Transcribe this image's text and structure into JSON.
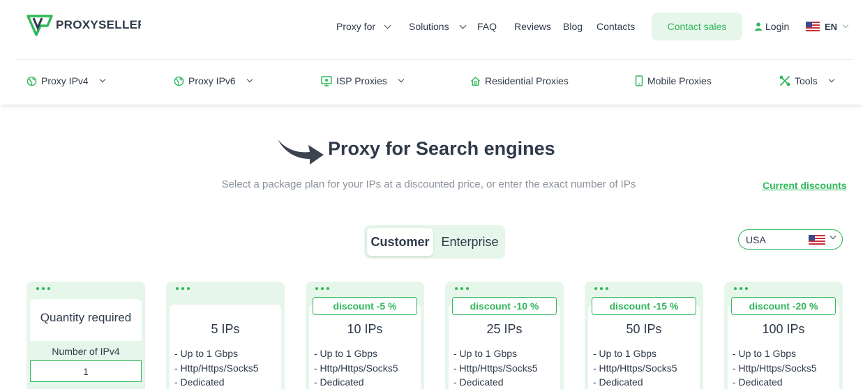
{
  "header": {
    "logo_text": "PROXYSELLER",
    "nav": [
      {
        "label": "Proxy for",
        "dropdown": true
      },
      {
        "label": "Solutions",
        "dropdown": true
      },
      {
        "label": "FAQ",
        "dropdown": false
      },
      {
        "label": "Reviews",
        "dropdown": false
      },
      {
        "label": "Blog",
        "dropdown": false
      },
      {
        "label": "Contacts",
        "dropdown": false
      }
    ],
    "contact_sales": "Contact sales",
    "login": "Login",
    "language": "EN"
  },
  "product_nav": [
    {
      "label": "Proxy IPv4",
      "icon": "globe-icon",
      "dropdown": true
    },
    {
      "label": "Proxy IPv6",
      "icon": "globe-icon",
      "dropdown": true
    },
    {
      "label": "ISP Proxies",
      "icon": "monitor-icon",
      "dropdown": true
    },
    {
      "label": "Residential Proxies",
      "icon": "home-icon",
      "dropdown": false
    },
    {
      "label": "Mobile Proxies",
      "icon": "phone-icon",
      "dropdown": false
    },
    {
      "label": "Tools",
      "icon": "tools-icon",
      "dropdown": true
    }
  ],
  "hero": {
    "title": "Proxy for Search engines",
    "subtitle": "Select a package plan for your IPs at a discounted price, or enter the exact number of IPs",
    "discounts_link": "Current discounts"
  },
  "plan_toggle": {
    "active": "Customer",
    "inactive": "Enterprise"
  },
  "country_select": {
    "value": "USA"
  },
  "quantity_card": {
    "title": "Quantity required",
    "label": "Number of IPv4",
    "value": "1"
  },
  "packages": [
    {
      "discount": "",
      "ips": "5 IPs",
      "features": [
        "- Up to 1 Gbps",
        "- Http/Https/Socks5",
        "- Dedicated"
      ]
    },
    {
      "discount": "discount -5 %",
      "ips": "10 IPs",
      "features": [
        "- Up to 1 Gbps",
        "- Http/Https/Socks5",
        "- Dedicated"
      ]
    },
    {
      "discount": "discount -10 %",
      "ips": "25 IPs",
      "features": [
        "- Up to 1 Gbps",
        "- Http/Https/Socks5",
        "- Dedicated"
      ]
    },
    {
      "discount": "discount -15 %",
      "ips": "50 IPs",
      "features": [
        "- Up to 1 Gbps",
        "- Http/Https/Socks5",
        "- Dedicated"
      ]
    },
    {
      "discount": "discount -20 %",
      "ips": "100 IPs",
      "features": [
        "- Up to 1 Gbps",
        "- Http/Https/Socks5",
        "- Dedicated"
      ]
    }
  ],
  "colors": {
    "accent": "#2fb75a",
    "accent_bg": "#e6f6ea",
    "text": "#2f3a4a",
    "muted": "#8a929c"
  }
}
